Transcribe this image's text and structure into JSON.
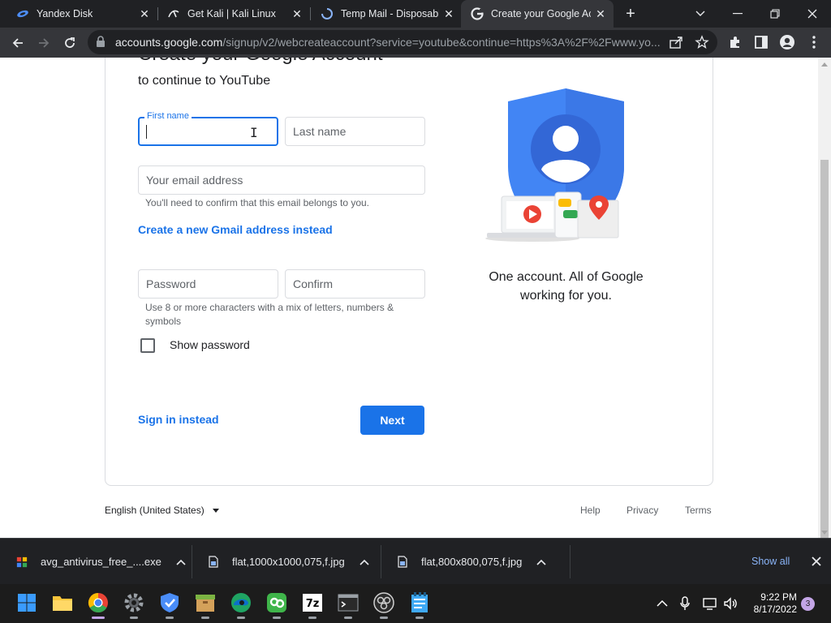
{
  "browser": {
    "tabs": [
      {
        "title": "Yandex Disk",
        "icon": "yandex-disk-icon",
        "active": false
      },
      {
        "title": "Get Kali | Kali Linux",
        "icon": "kali-dragon-icon",
        "active": false
      },
      {
        "title": "Temp Mail - Disposable",
        "icon": "loading-spinner-icon",
        "active": false
      },
      {
        "title": "Create your Google Ac",
        "icon": "google-g-icon",
        "active": true
      }
    ],
    "url_host": "accounts.google.com",
    "url_path": "/signup/v2/webcreateaccount?service=youtube&continue=https%3A%2F%2Fwww.yo..."
  },
  "form": {
    "partial_heading": "Create your Google Account",
    "subheading": "to continue to YouTube",
    "first_name_label": "First name",
    "first_name_value": "",
    "last_name_placeholder": "Last name",
    "email_placeholder": "Your email address",
    "email_hint": "You'll need to confirm that this email belongs to you.",
    "gmail_link": "Create a new Gmail address instead",
    "password_placeholder": "Password",
    "confirm_placeholder": "Confirm",
    "password_hint": "Use 8 or more characters with a mix of letters, numbers & symbols",
    "show_password_label": "Show password",
    "show_password_checked": false,
    "sign_in_link": "Sign in instead",
    "next_button": "Next"
  },
  "side": {
    "tagline_line1": "One account. All of Google",
    "tagline_line2": "working for you."
  },
  "footer": {
    "language": "English (United States)",
    "help": "Help",
    "privacy": "Privacy",
    "terms": "Terms"
  },
  "downloads": {
    "items": [
      {
        "name": "avg_antivirus_free_....exe",
        "icon": "avg-installer-icon"
      },
      {
        "name": "flat,1000x1000,075,f.jpg",
        "icon": "image-file-icon"
      },
      {
        "name": "flat,800x800,075,f.jpg",
        "icon": "image-file-icon"
      }
    ],
    "show_all": "Show all"
  },
  "taskbar": {
    "time": "9:22 PM",
    "date": "8/17/2022",
    "notifications": "3"
  },
  "colors": {
    "google_blue": "#1a73e8",
    "chrome_dark": "#202124",
    "chrome_toolbar": "#35363a",
    "taskbar": "#1c1c1c"
  }
}
